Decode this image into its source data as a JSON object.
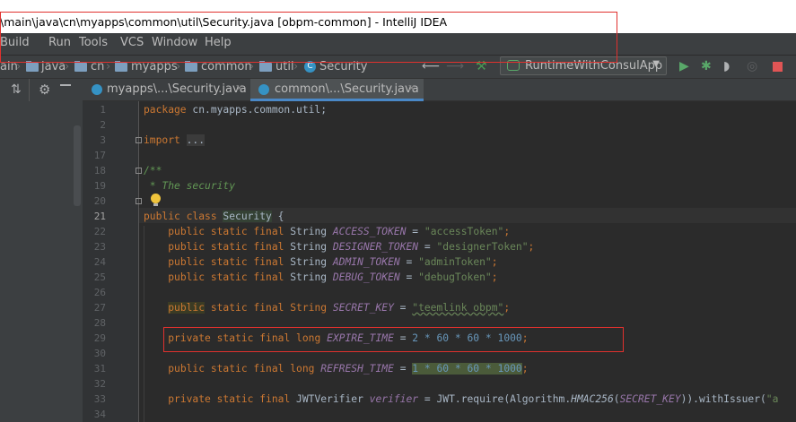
{
  "window": {
    "title": "\\main\\java\\cn\\myapps\\common\\util\\Security.java [obpm-common] - IntelliJ IDEA"
  },
  "menu": {
    "items": [
      "Build",
      "Run",
      "Tools",
      "VCS",
      "Window",
      "Help"
    ]
  },
  "breadcrumb": {
    "items": [
      "ain",
      "java",
      "cn",
      "myapps",
      "common",
      "util",
      "Security"
    ]
  },
  "toolbar": {
    "run_config": "RuntimeWithConsulApp"
  },
  "tabs": [
    {
      "label": "myapps\\...\\Security.java",
      "active": false
    },
    {
      "label": "common\\...\\Security.java",
      "active": true
    }
  ],
  "editor": {
    "line_numbers": [
      "1",
      "2",
      "3",
      "17",
      "18",
      "19",
      "20",
      "21",
      "22",
      "23",
      "24",
      "25",
      "26",
      "27",
      "28",
      "29",
      "30",
      "31",
      "32",
      "33",
      "34"
    ],
    "current_line": "21",
    "code": {
      "package_kw": "package",
      "package_name": " cn.myapps.common.util;",
      "import_kw": "import",
      "import_fold": "...",
      "doc_open": "/**",
      "doc_line": " * The security",
      "class_decl_kw": "public class ",
      "class_name": "Security",
      "class_brace": " {",
      "mods": "public static final",
      "private_mods": "private static final",
      "type_string": " String ",
      "type_long": " long ",
      "type_verifier": " JWTVerifier ",
      "access_token_name": "ACCESS_TOKEN",
      "access_token_value": "\"accessToken\"",
      "designer_token_name": "DESIGNER_TOKEN",
      "designer_token_value": "\"designerToken\"",
      "admin_token_name": "ADMIN_TOKEN",
      "admin_token_value": "\"adminToken\"",
      "debug_token_name": "DEBUG_TOKEN",
      "debug_token_value": "\"debugToken\"",
      "public_kw": "public",
      "static_final_string": " static final String ",
      "secret_key_name": "SECRET_KEY",
      "secret_key_value": "\"teemlink obpm\"",
      "expire_time_name": "EXPIRE_TIME",
      "expire_time_expr": "2 * 60 * 60 * 1000",
      "refresh_time_name": "REFRESH_TIME",
      "refresh_time_expr": "1 * 60 * 60 * 1000",
      "verifier_name": "verifier",
      "verifier_expr_1": "JWT.require(Algorithm.",
      "verifier_method": "HMAC256",
      "verifier_arg": "SECRET_KEY",
      "verifier_expr_2": ")).withIssuer(",
      "verifier_expr_3": "\"a"
    }
  },
  "colors": {
    "highlight_box": "#e0312e",
    "run_green": "#59a869",
    "stop_red": "#e05555"
  }
}
